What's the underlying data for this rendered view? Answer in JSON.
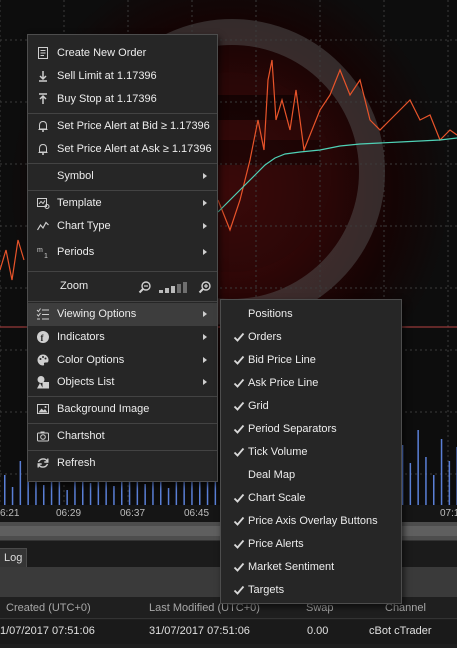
{
  "chart": {
    "time_labels": [
      "6:21",
      "06:29",
      "06:37",
      "06:45",
      "07:1"
    ]
  },
  "context_menu": {
    "create_order": "Create New Order",
    "sell_limit": "Sell Limit at 1.17396",
    "buy_stop": "Buy Stop at 1.17396",
    "alert_bid": "Set Price Alert at Bid ≥ 1.17396",
    "alert_ask": "Set Price Alert at Ask ≥ 1.17396",
    "symbol": "Symbol",
    "template": "Template",
    "chart_type": "Chart Type",
    "periods": "Periods",
    "zoom": "Zoom",
    "viewing_options": "Viewing Options",
    "indicators": "Indicators",
    "color_options": "Color Options",
    "objects_list": "Objects List",
    "background_image": "Background Image",
    "chartshot": "Chartshot",
    "refresh": "Refresh"
  },
  "viewing_options": [
    {
      "label": "Positions",
      "checked": false
    },
    {
      "label": "Orders",
      "checked": true
    },
    {
      "label": "Bid Price Line",
      "checked": true
    },
    {
      "label": "Ask Price Line",
      "checked": true
    },
    {
      "label": "Grid",
      "checked": true
    },
    {
      "label": "Period Separators",
      "checked": true
    },
    {
      "label": "Tick Volume",
      "checked": true
    },
    {
      "label": "Deal Map",
      "checked": false
    },
    {
      "label": "Chart Scale",
      "checked": true
    },
    {
      "label": "Price Axis Overlay Buttons",
      "checked": true
    },
    {
      "label": "Price Alerts",
      "checked": true
    },
    {
      "label": "Market Sentiment",
      "checked": true
    },
    {
      "label": "Targets",
      "checked": true
    }
  ],
  "bottom_panel": {
    "tab_log": "Log",
    "columns": {
      "created": "Created (UTC+0)",
      "last_modified": "Last Modified (UTC+0)",
      "swap": "Swap",
      "channel": "Channel"
    },
    "row": {
      "created": "1/07/2017 07:51:06",
      "last_modified": "31/07/2017 07:51:06",
      "swap": "0.00",
      "channel": "cBot cTrader"
    }
  },
  "colors": {
    "bid_line": "#e8542a",
    "ask_line": "#4fd1b6",
    "volume": "#5a7fd6",
    "checkmark": "#d9d9d9",
    "menu_bg": "#262626"
  }
}
